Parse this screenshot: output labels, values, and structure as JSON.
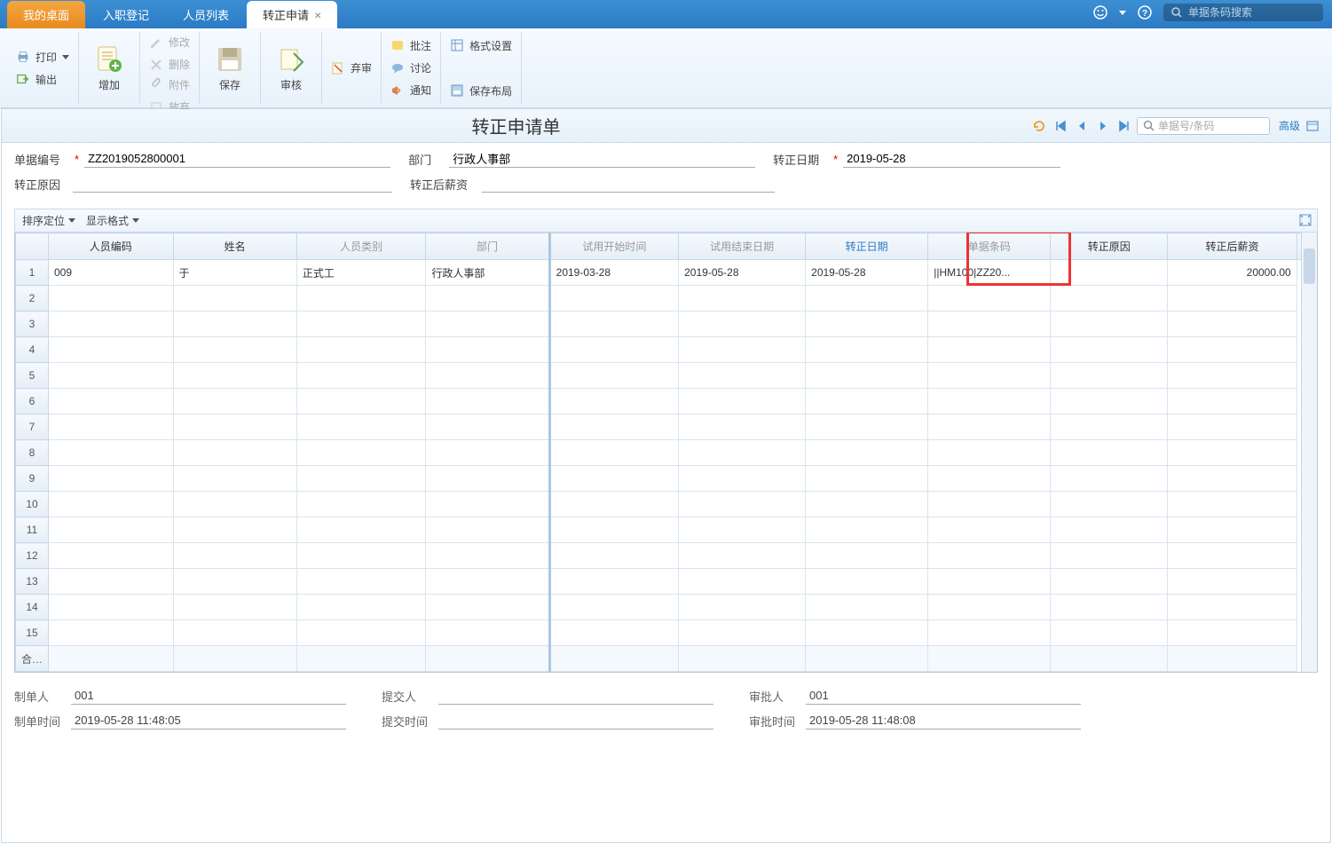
{
  "tabs": {
    "home": "我的桌面",
    "t1": "入职登记",
    "t2": "人员列表",
    "t3": "转正申请"
  },
  "top_search": {
    "placeholder": "单据条码搜索"
  },
  "ribbon": {
    "print": "打印",
    "output": "输出",
    "add": "增加",
    "modify": "修改",
    "delete": "删除",
    "attachment": "附件",
    "discard": "放弃",
    "save": "保存",
    "audit": "审核",
    "abandon": "弃审",
    "note": "批注",
    "discuss": "讨论",
    "notify": "通知",
    "format": "格式设置",
    "save_layout": "保存布局"
  },
  "title": "转正申请单",
  "title_search": {
    "placeholder": "单据号/条码"
  },
  "adv": "高级",
  "form": {
    "doc_no_label": "单据编号",
    "doc_no": "ZZ2019052800001",
    "dept_label": "部门",
    "dept": "行政人事部",
    "date_label": "转正日期",
    "date": "2019-05-28",
    "reason_label": "转正原因",
    "reason": "",
    "salary_label": "转正后薪资",
    "salary": ""
  },
  "grid_toolbar": {
    "sort": "排序定位",
    "format": "显示格式"
  },
  "grid": {
    "headers": {
      "code": "人员编码",
      "name": "姓名",
      "type": "人员类别",
      "dept": "部门",
      "trial_start": "试用开始时间",
      "trial_end": "试用结束日期",
      "reg_date": "转正日期",
      "barcode": "单据条码",
      "reason": "转正原因",
      "salary": "转正后薪资"
    },
    "rows": [
      {
        "code": "009",
        "name": "于",
        "type": "正式工",
        "dept": "行政人事部",
        "trial_start": "2019-03-28",
        "trial_end": "2019-05-28",
        "reg_date": "2019-05-28",
        "barcode": "||HM100|ZZ20...",
        "reason": "",
        "salary": "20000.00"
      }
    ],
    "total_label": "合计"
  },
  "footer": {
    "creator_label": "制单人",
    "creator": "001",
    "submitter_label": "提交人",
    "submitter": "",
    "approver_label": "审批人",
    "approver": "001",
    "create_time_label": "制单时间",
    "create_time": "2019-05-28 11:48:05",
    "submit_time_label": "提交时间",
    "submit_time": "",
    "approve_time_label": "审批时间",
    "approve_time": "2019-05-28 11:48:08"
  }
}
